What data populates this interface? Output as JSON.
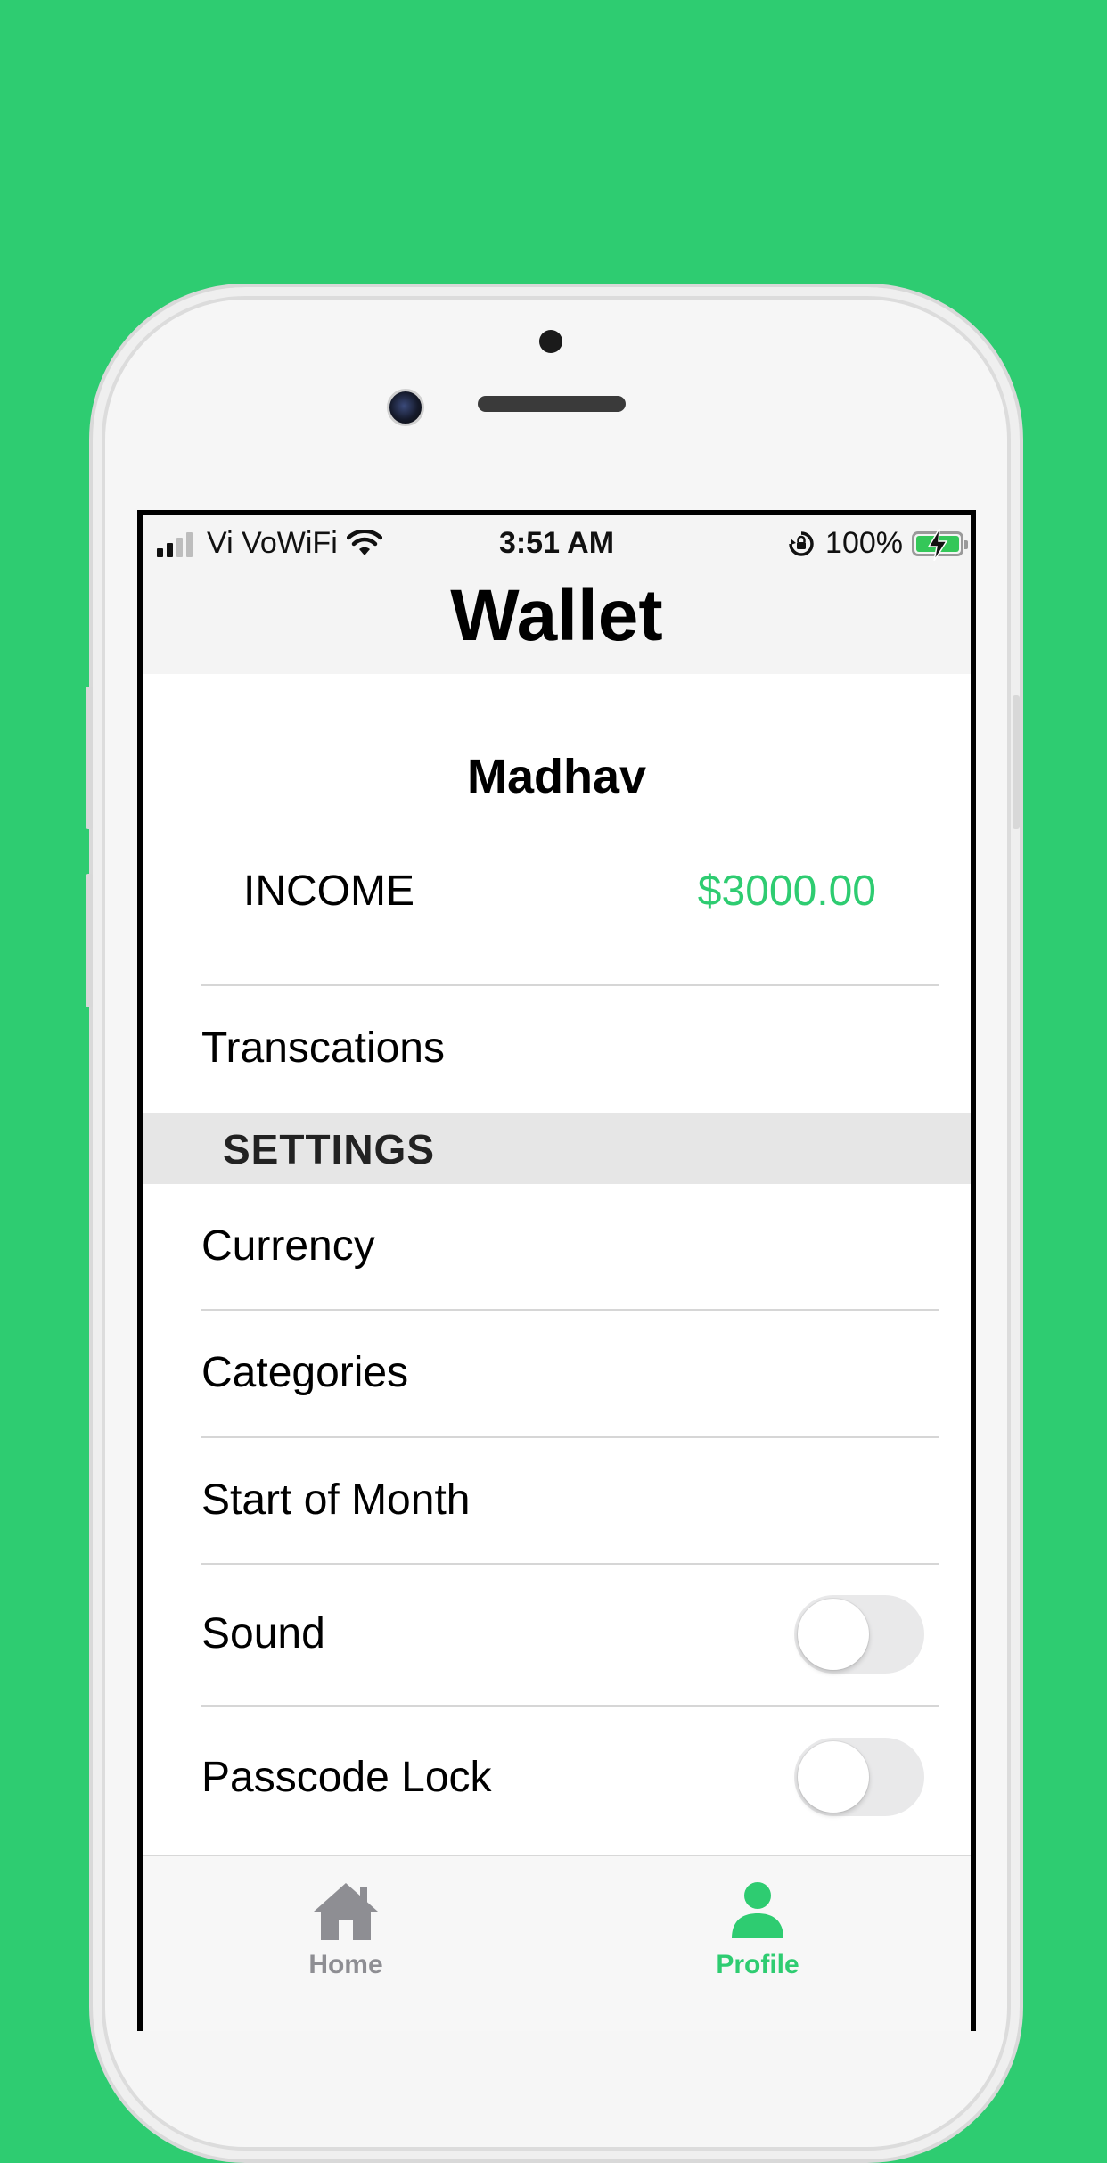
{
  "status_bar": {
    "carrier": "Vi VoWiFi",
    "time": "3:51 AM",
    "battery_percent": "100%"
  },
  "nav": {
    "title": "Wallet"
  },
  "profile": {
    "name": "Madhav",
    "income_label": "INCOME",
    "income_value": "$3000.00"
  },
  "menu": {
    "transactions": "Transcations"
  },
  "settings": {
    "header": "SETTINGS",
    "items": {
      "currency": "Currency",
      "categories": "Categories",
      "start_of_month": "Start of Month",
      "sound": "Sound",
      "passcode_lock": "Passcode Lock"
    },
    "sound_enabled": false,
    "passcode_enabled": false
  },
  "tabs": [
    {
      "label": "Home",
      "icon": "house-icon",
      "active": false
    },
    {
      "label": "Profile",
      "icon": "person-icon",
      "active": true
    }
  ],
  "colors": {
    "accent": "#2ecc71",
    "background": "#2ecc71",
    "inactive_tab": "#8e8e93"
  }
}
